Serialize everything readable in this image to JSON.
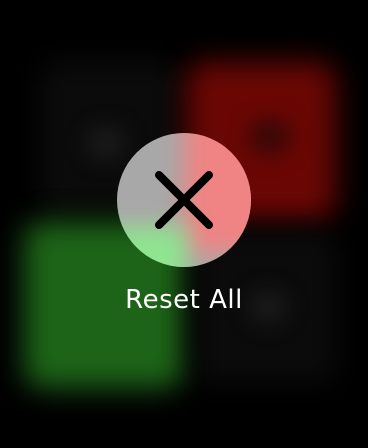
{
  "reset": {
    "label": "Reset All",
    "icon": "close-icon"
  },
  "colors": {
    "background": "#000000",
    "button": "#a8a8a8",
    "accent_red": "#f08383",
    "accent_green": "#8fe58f",
    "tile_red": "#6a0704",
    "tile_green": "#1d6418",
    "label": "#ffffff"
  }
}
